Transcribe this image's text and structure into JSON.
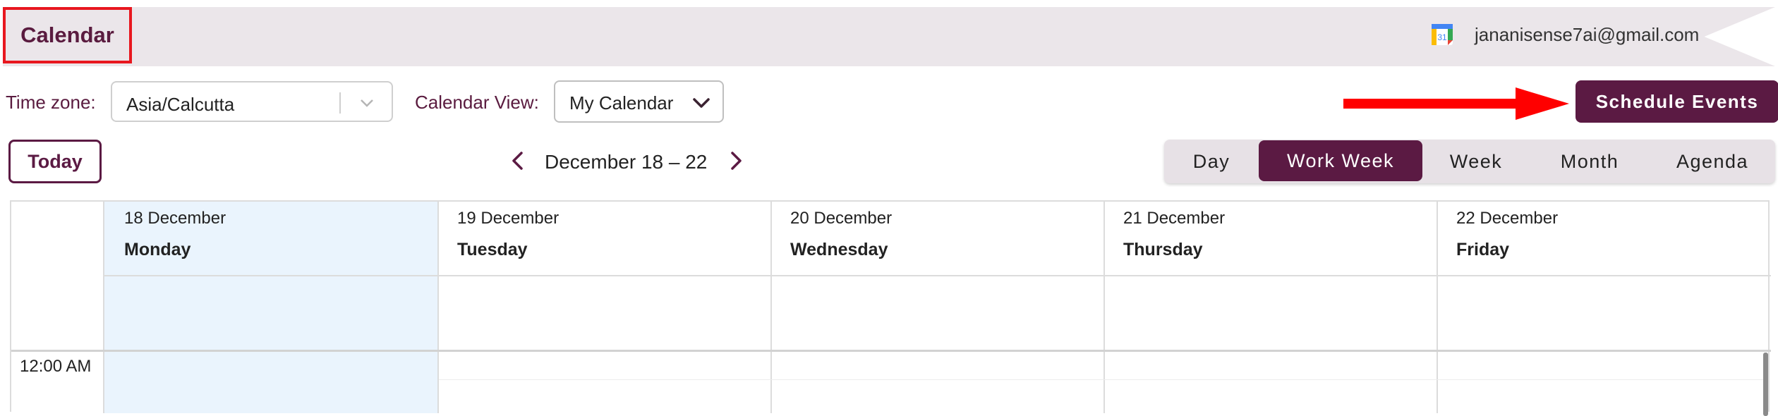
{
  "header": {
    "title": "Calendar",
    "account_email": "jananisense7ai@gmail.com",
    "account_icon": "google-calendar-icon",
    "icon_day": "31"
  },
  "toolbar": {
    "timezone_label": "Time zone:",
    "timezone_value": "Asia/Calcutta",
    "calendar_view_label": "Calendar View:",
    "calendar_view_value": "My Calendar",
    "schedule_label": "Schedule Events",
    "today_label": "Today",
    "date_range": "December 18 – 22"
  },
  "views": [
    {
      "label": "Day",
      "active": false
    },
    {
      "label": "Work Week",
      "active": true
    },
    {
      "label": "Week",
      "active": false
    },
    {
      "label": "Month",
      "active": false
    },
    {
      "label": "Agenda",
      "active": false
    }
  ],
  "days": [
    {
      "date": "18 December",
      "name": "Monday"
    },
    {
      "date": "19 December",
      "name": "Tuesday"
    },
    {
      "date": "20 December",
      "name": "Wednesday"
    },
    {
      "date": "21 December",
      "name": "Thursday"
    },
    {
      "date": "22 December",
      "name": "Friday"
    }
  ],
  "time_slots": [
    "12:00 AM"
  ],
  "colors": {
    "brand": "#5b1a43",
    "banner": "#ebe6ea",
    "today_column": "#eaf4fd",
    "highlight_box": "#e8171f",
    "annotation_arrow": "#ff0000"
  }
}
